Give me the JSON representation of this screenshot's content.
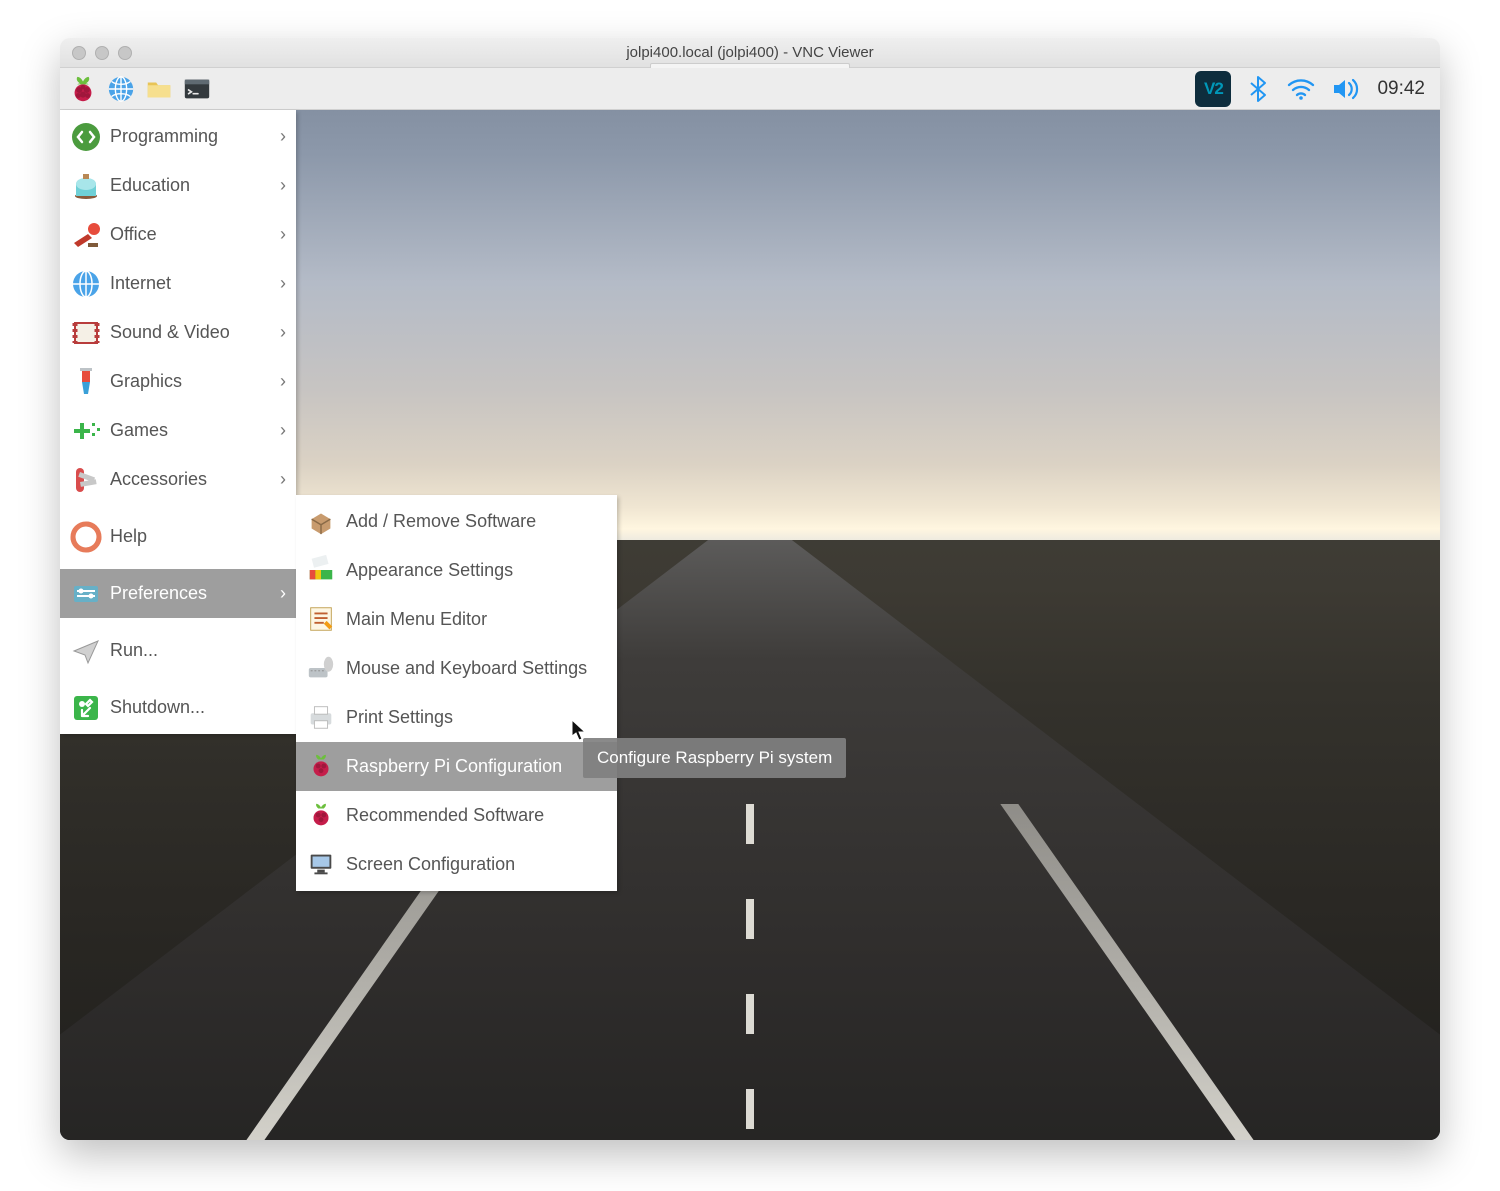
{
  "mac_title": "jolpi400.local (jolpi400) - VNC Viewer",
  "tray": {
    "vnc": "V2",
    "time": "09:42"
  },
  "menu": [
    {
      "id": "programming",
      "label": "Programming",
      "sub": true
    },
    {
      "id": "education",
      "label": "Education",
      "sub": true
    },
    {
      "id": "office",
      "label": "Office",
      "sub": true
    },
    {
      "id": "internet",
      "label": "Internet",
      "sub": true
    },
    {
      "id": "sound-video",
      "label": "Sound & Video",
      "sub": true
    },
    {
      "id": "graphics",
      "label": "Graphics",
      "sub": true
    },
    {
      "id": "games",
      "label": "Games",
      "sub": true
    },
    {
      "id": "accessories",
      "label": "Accessories",
      "sub": true
    },
    null,
    {
      "id": "help",
      "label": "Help",
      "sub": false
    },
    null,
    {
      "id": "preferences",
      "label": "Preferences",
      "sub": true,
      "selected": true
    },
    null,
    {
      "id": "run",
      "label": "Run...",
      "sub": false
    },
    null,
    {
      "id": "shutdown",
      "label": "Shutdown...",
      "sub": false
    }
  ],
  "submenu": [
    {
      "id": "add-remove",
      "label": "Add / Remove Software"
    },
    {
      "id": "appearance",
      "label": "Appearance Settings"
    },
    {
      "id": "mainmenu",
      "label": "Main Menu Editor"
    },
    {
      "id": "mouse-keyboard",
      "label": "Mouse and Keyboard Settings"
    },
    {
      "id": "print",
      "label": "Print Settings"
    },
    {
      "id": "rpi-config",
      "label": "Raspberry Pi Configuration",
      "selected": true
    },
    {
      "id": "recommended",
      "label": "Recommended Software"
    },
    {
      "id": "screen-config",
      "label": "Screen Configuration"
    }
  ],
  "tooltip": "Configure Raspberry Pi system",
  "launchers": [
    "raspberry",
    "web-browser",
    "file-manager",
    "terminal"
  ]
}
